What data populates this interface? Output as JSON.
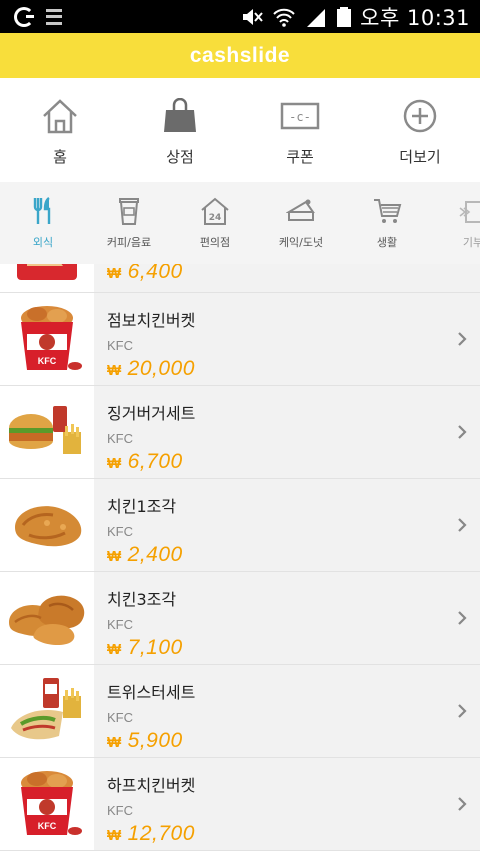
{
  "status_bar": {
    "time": "오후 10:31"
  },
  "app": {
    "title": "cashslide"
  },
  "main_nav": [
    {
      "label": "홈",
      "icon": "home-icon"
    },
    {
      "label": "상점",
      "icon": "shopping-bag-icon"
    },
    {
      "label": "쿠폰",
      "icon": "coupon-icon"
    },
    {
      "label": "더보기",
      "icon": "plus-circle-icon"
    }
  ],
  "categories": [
    {
      "label": "외식",
      "icon": "fork-knife-icon",
      "active": true
    },
    {
      "label": "커피/음료",
      "icon": "coffee-cup-icon",
      "active": false
    },
    {
      "label": "편의점",
      "icon": "convenience-store-icon",
      "active": false
    },
    {
      "label": "케익/도넛",
      "icon": "cake-icon",
      "active": false
    },
    {
      "label": "생활",
      "icon": "cart-icon",
      "active": false
    },
    {
      "label": "기부",
      "icon": "gift-icon",
      "active": false
    }
  ],
  "currency_symbol": "₩",
  "partial_item": {
    "price": "6,400"
  },
  "items": [
    {
      "name": "점보치킨버켓",
      "brand": "KFC",
      "price": "20,000",
      "image": "bucket"
    },
    {
      "name": "징거버거세트",
      "brand": "KFC",
      "price": "6,700",
      "image": "burger"
    },
    {
      "name": "치킨1조각",
      "brand": "KFC",
      "price": "2,400",
      "image": "chicken1"
    },
    {
      "name": "치킨3조각",
      "brand": "KFC",
      "price": "7,100",
      "image": "chicken3"
    },
    {
      "name": "트위스터세트",
      "brand": "KFC",
      "price": "5,900",
      "image": "twister"
    },
    {
      "name": "하프치킨버켓",
      "brand": "KFC",
      "price": "12,700",
      "image": "bucket"
    }
  ],
  "colors": {
    "brand_yellow": "#f8de3b",
    "price_orange": "#f5a000",
    "active_blue": "#3aa6c9"
  }
}
